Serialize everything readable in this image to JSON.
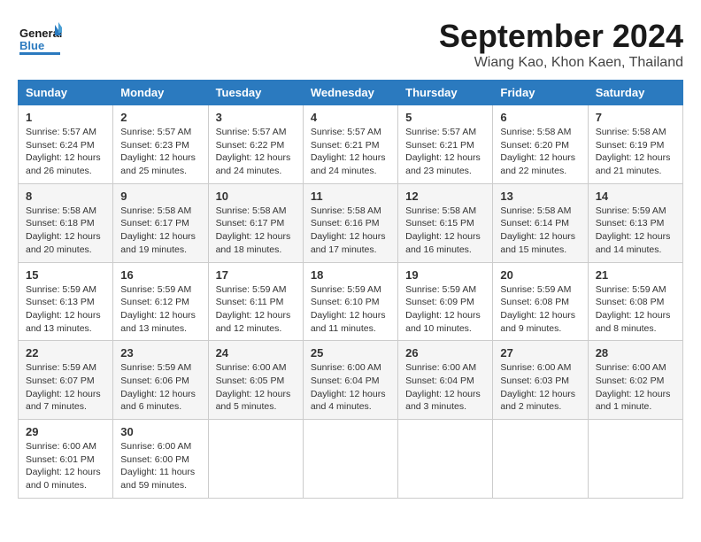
{
  "header": {
    "logo_line1": "General",
    "logo_line2": "Blue",
    "month_title": "September 2024",
    "location": "Wiang Kao, Khon Kaen, Thailand"
  },
  "weekdays": [
    "Sunday",
    "Monday",
    "Tuesday",
    "Wednesday",
    "Thursday",
    "Friday",
    "Saturday"
  ],
  "weeks": [
    [
      {
        "day": "1",
        "sunrise": "5:57 AM",
        "sunset": "6:24 PM",
        "daylight": "12 hours and 26 minutes."
      },
      {
        "day": "2",
        "sunrise": "5:57 AM",
        "sunset": "6:23 PM",
        "daylight": "12 hours and 25 minutes."
      },
      {
        "day": "3",
        "sunrise": "5:57 AM",
        "sunset": "6:22 PM",
        "daylight": "12 hours and 24 minutes."
      },
      {
        "day": "4",
        "sunrise": "5:57 AM",
        "sunset": "6:21 PM",
        "daylight": "12 hours and 24 minutes."
      },
      {
        "day": "5",
        "sunrise": "5:57 AM",
        "sunset": "6:21 PM",
        "daylight": "12 hours and 23 minutes."
      },
      {
        "day": "6",
        "sunrise": "5:58 AM",
        "sunset": "6:20 PM",
        "daylight": "12 hours and 22 minutes."
      },
      {
        "day": "7",
        "sunrise": "5:58 AM",
        "sunset": "6:19 PM",
        "daylight": "12 hours and 21 minutes."
      }
    ],
    [
      {
        "day": "8",
        "sunrise": "5:58 AM",
        "sunset": "6:18 PM",
        "daylight": "12 hours and 20 minutes."
      },
      {
        "day": "9",
        "sunrise": "5:58 AM",
        "sunset": "6:17 PM",
        "daylight": "12 hours and 19 minutes."
      },
      {
        "day": "10",
        "sunrise": "5:58 AM",
        "sunset": "6:17 PM",
        "daylight": "12 hours and 18 minutes."
      },
      {
        "day": "11",
        "sunrise": "5:58 AM",
        "sunset": "6:16 PM",
        "daylight": "12 hours and 17 minutes."
      },
      {
        "day": "12",
        "sunrise": "5:58 AM",
        "sunset": "6:15 PM",
        "daylight": "12 hours and 16 minutes."
      },
      {
        "day": "13",
        "sunrise": "5:58 AM",
        "sunset": "6:14 PM",
        "daylight": "12 hours and 15 minutes."
      },
      {
        "day": "14",
        "sunrise": "5:59 AM",
        "sunset": "6:13 PM",
        "daylight": "12 hours and 14 minutes."
      }
    ],
    [
      {
        "day": "15",
        "sunrise": "5:59 AM",
        "sunset": "6:13 PM",
        "daylight": "12 hours and 13 minutes."
      },
      {
        "day": "16",
        "sunrise": "5:59 AM",
        "sunset": "6:12 PM",
        "daylight": "12 hours and 13 minutes."
      },
      {
        "day": "17",
        "sunrise": "5:59 AM",
        "sunset": "6:11 PM",
        "daylight": "12 hours and 12 minutes."
      },
      {
        "day": "18",
        "sunrise": "5:59 AM",
        "sunset": "6:10 PM",
        "daylight": "12 hours and 11 minutes."
      },
      {
        "day": "19",
        "sunrise": "5:59 AM",
        "sunset": "6:09 PM",
        "daylight": "12 hours and 10 minutes."
      },
      {
        "day": "20",
        "sunrise": "5:59 AM",
        "sunset": "6:08 PM",
        "daylight": "12 hours and 9 minutes."
      },
      {
        "day": "21",
        "sunrise": "5:59 AM",
        "sunset": "6:08 PM",
        "daylight": "12 hours and 8 minutes."
      }
    ],
    [
      {
        "day": "22",
        "sunrise": "5:59 AM",
        "sunset": "6:07 PM",
        "daylight": "12 hours and 7 minutes."
      },
      {
        "day": "23",
        "sunrise": "5:59 AM",
        "sunset": "6:06 PM",
        "daylight": "12 hours and 6 minutes."
      },
      {
        "day": "24",
        "sunrise": "6:00 AM",
        "sunset": "6:05 PM",
        "daylight": "12 hours and 5 minutes."
      },
      {
        "day": "25",
        "sunrise": "6:00 AM",
        "sunset": "6:04 PM",
        "daylight": "12 hours and 4 minutes."
      },
      {
        "day": "26",
        "sunrise": "6:00 AM",
        "sunset": "6:04 PM",
        "daylight": "12 hours and 3 minutes."
      },
      {
        "day": "27",
        "sunrise": "6:00 AM",
        "sunset": "6:03 PM",
        "daylight": "12 hours and 2 minutes."
      },
      {
        "day": "28",
        "sunrise": "6:00 AM",
        "sunset": "6:02 PM",
        "daylight": "12 hours and 1 minute."
      }
    ],
    [
      {
        "day": "29",
        "sunrise": "6:00 AM",
        "sunset": "6:01 PM",
        "daylight": "12 hours and 0 minutes."
      },
      {
        "day": "30",
        "sunrise": "6:00 AM",
        "sunset": "6:00 PM",
        "daylight": "11 hours and 59 minutes."
      },
      null,
      null,
      null,
      null,
      null
    ]
  ]
}
